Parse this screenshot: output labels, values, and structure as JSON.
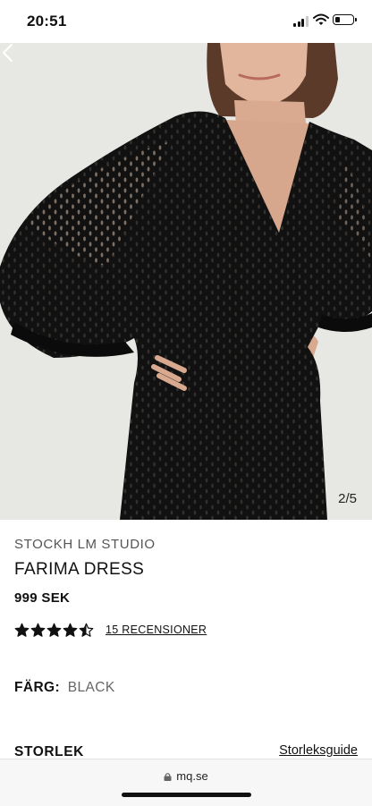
{
  "status_bar": {
    "time": "20:51"
  },
  "gallery": {
    "counter": "2/5",
    "current_image": 2,
    "total_images": 5
  },
  "product": {
    "brand": "STOCKH LM STUDIO",
    "name": "FARIMA DRESS",
    "price": "999 SEK",
    "rating": 4.5,
    "rating_max": 5,
    "reviews_link": "15 RECENSIONER",
    "color_label": "FÄRG:",
    "color_value": "BLACK",
    "size_label": "STORLEK",
    "size_guide_link": "Storleksguide"
  },
  "browser": {
    "url": "mq.se"
  },
  "colors": {
    "background": "#ffffff",
    "image_bg": "#e7e7e4",
    "dress": "#111111",
    "text": "#111111",
    "muted_text": "#666666"
  },
  "icons": [
    "signal-icon",
    "wifi-icon",
    "battery-icon",
    "chevron-left-icon",
    "star-icon",
    "lock-icon"
  ]
}
